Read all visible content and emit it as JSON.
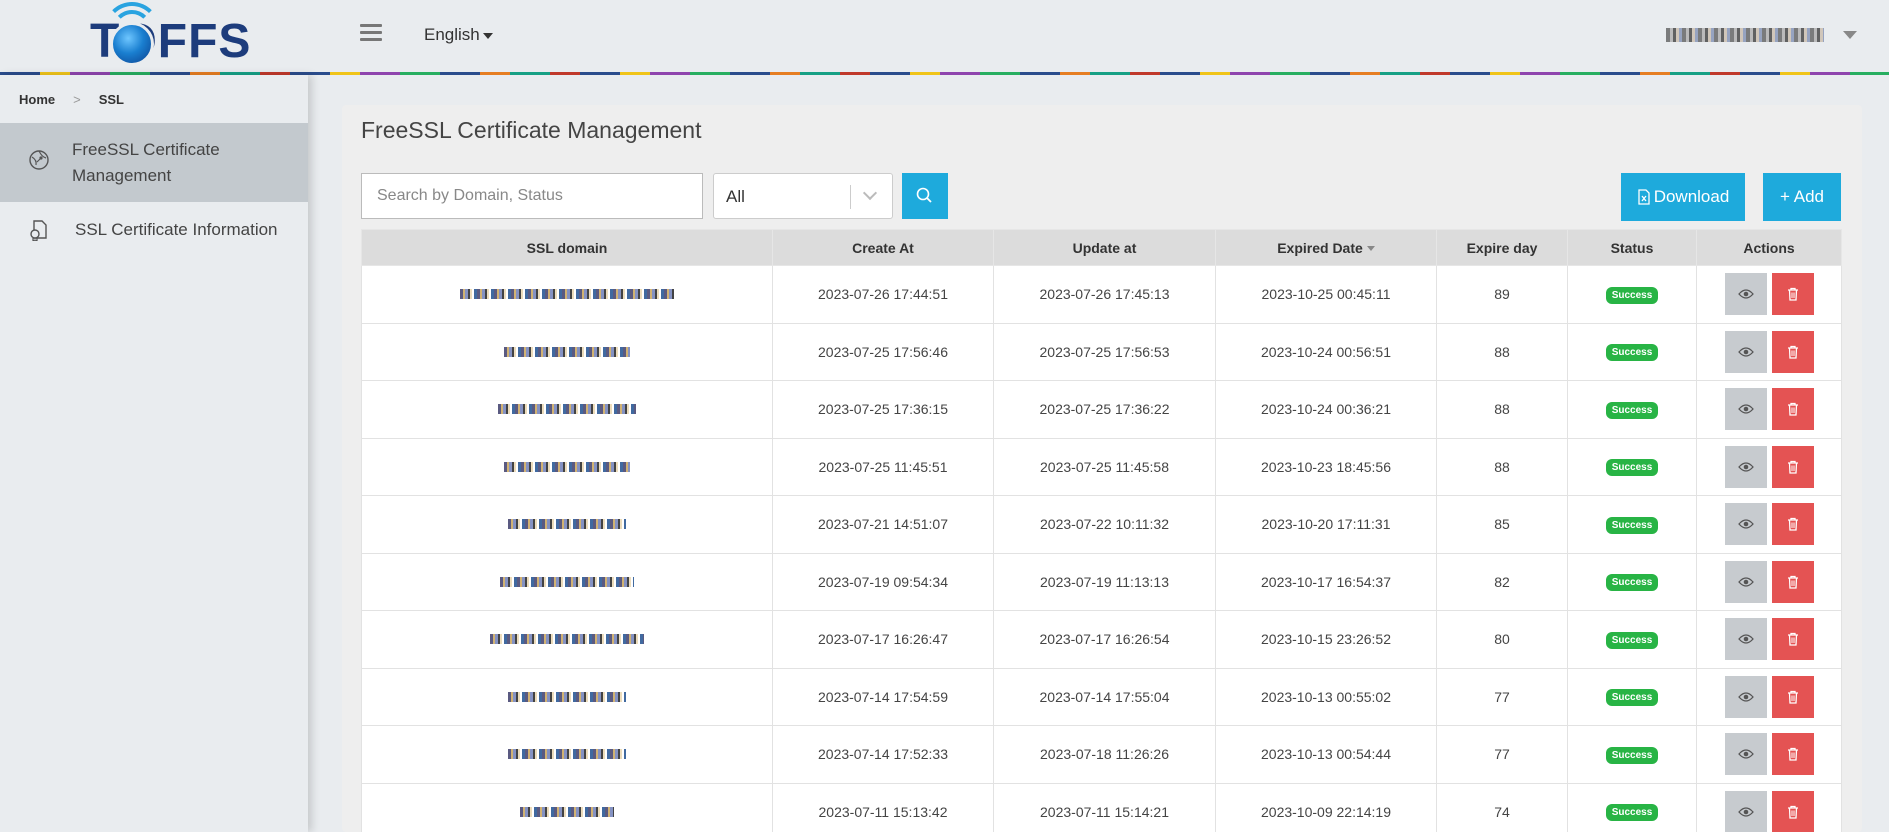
{
  "header": {
    "logo_text": "TOFFS",
    "language": "English",
    "user_name": "",
    "colors": {
      "accent": "#1eaadc",
      "delete": "#e45353",
      "success": "#28b445"
    }
  },
  "breadcrumb": {
    "home": "Home",
    "current": "SSL"
  },
  "sidebar": {
    "items": [
      {
        "label": "FreeSSL Certificate Management",
        "icon": "ssl-globe-icon",
        "active": true
      },
      {
        "label": "SSL Certificate Information",
        "icon": "certificate-doc-icon",
        "active": false
      }
    ]
  },
  "main": {
    "title": "FreeSSL Certificate Management",
    "search": {
      "placeholder": "Search by Domain, Status",
      "value": ""
    },
    "filter": {
      "selected": "All"
    },
    "buttons": {
      "download": "Download",
      "add": "+ Add"
    },
    "table": {
      "columns": [
        "SSL domain",
        "Create At",
        "Update at",
        "Expired Date",
        "Expire day",
        "Status",
        "Actions"
      ],
      "sorted_column": "Expired Date",
      "rows": [
        {
          "domain": "",
          "created": "2023-07-26 17:44:51",
          "updated": "2023-07-26 17:45:13",
          "expired": "2023-10-25 00:45:11",
          "expire_day": "89",
          "status": "Success"
        },
        {
          "domain": "",
          "created": "2023-07-25 17:56:46",
          "updated": "2023-07-25 17:56:53",
          "expired": "2023-10-24 00:56:51",
          "expire_day": "88",
          "status": "Success"
        },
        {
          "domain": "",
          "created": "2023-07-25 17:36:15",
          "updated": "2023-07-25 17:36:22",
          "expired": "2023-10-24 00:36:21",
          "expire_day": "88",
          "status": "Success"
        },
        {
          "domain": "",
          "created": "2023-07-25 11:45:51",
          "updated": "2023-07-25 11:45:58",
          "expired": "2023-10-23 18:45:56",
          "expire_day": "88",
          "status": "Success"
        },
        {
          "domain": "",
          "created": "2023-07-21 14:51:07",
          "updated": "2023-07-22 10:11:32",
          "expired": "2023-10-20 17:11:31",
          "expire_day": "85",
          "status": "Success"
        },
        {
          "domain": "",
          "created": "2023-07-19 09:54:34",
          "updated": "2023-07-19 11:13:13",
          "expired": "2023-10-17 16:54:37",
          "expire_day": "82",
          "status": "Success"
        },
        {
          "domain": "",
          "created": "2023-07-17 16:26:47",
          "updated": "2023-07-17 16:26:54",
          "expired": "2023-10-15 23:26:52",
          "expire_day": "80",
          "status": "Success"
        },
        {
          "domain": "",
          "created": "2023-07-14 17:54:59",
          "updated": "2023-07-14 17:55:04",
          "expired": "2023-10-13 00:55:02",
          "expire_day": "77",
          "status": "Success"
        },
        {
          "domain": "",
          "created": "2023-07-14 17:52:33",
          "updated": "2023-07-18 11:26:26",
          "expired": "2023-10-13 00:54:44",
          "expire_day": "77",
          "status": "Success"
        },
        {
          "domain": "",
          "created": "2023-07-11 15:13:42",
          "updated": "2023-07-11 15:14:21",
          "expired": "2023-10-09 22:14:19",
          "expire_day": "74",
          "status": "Success"
        }
      ]
    }
  }
}
